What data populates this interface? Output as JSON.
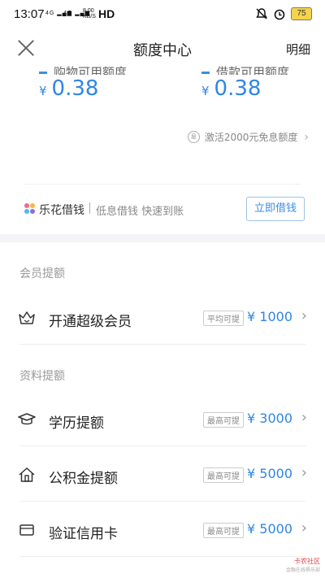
{
  "status": {
    "time": "13:07",
    "signal1": "4G",
    "signal2": "4G",
    "speed_value": "8.00",
    "speed_unit": "KB/S",
    "hd": "HD",
    "battery": "75"
  },
  "nav": {
    "title": "额度中心",
    "detail": "明细"
  },
  "limits": [
    {
      "label": "购物可用额度",
      "currency": "¥",
      "value": "0.38"
    },
    {
      "label": "借款可用额度",
      "currency": "¥",
      "value": "0.38"
    }
  ],
  "activate": {
    "badge": "息",
    "text": "激活2000元免息额度"
  },
  "promo": {
    "brand": "乐花借钱",
    "desc": "低息借钱 快速到账",
    "button": "立即借钱"
  },
  "sections": [
    {
      "title": "会员提额",
      "items": [
        {
          "icon": "crown-icon",
          "label": "开通超级会员",
          "tag": "平均可提",
          "amount": "¥ 1000"
        }
      ]
    },
    {
      "title": "资料提额",
      "items": [
        {
          "icon": "graduation-cap-icon",
          "label": "学历提额",
          "tag": "最高可提",
          "amount": "¥ 3000"
        },
        {
          "icon": "house-icon",
          "label": "公积金提额",
          "tag": "最高可提",
          "amount": "¥ 5000"
        },
        {
          "icon": "credit-card-icon",
          "label": "验证信用卡",
          "tag": "最高可提",
          "amount": "¥ 5000"
        }
      ]
    }
  ],
  "watermark": {
    "title": "卡农社区",
    "sub": "金融在线俱乐部"
  },
  "colors": {
    "accent": "#2f86e6",
    "divider": "#eeeeee",
    "section_bg": "#f4f4f6"
  }
}
